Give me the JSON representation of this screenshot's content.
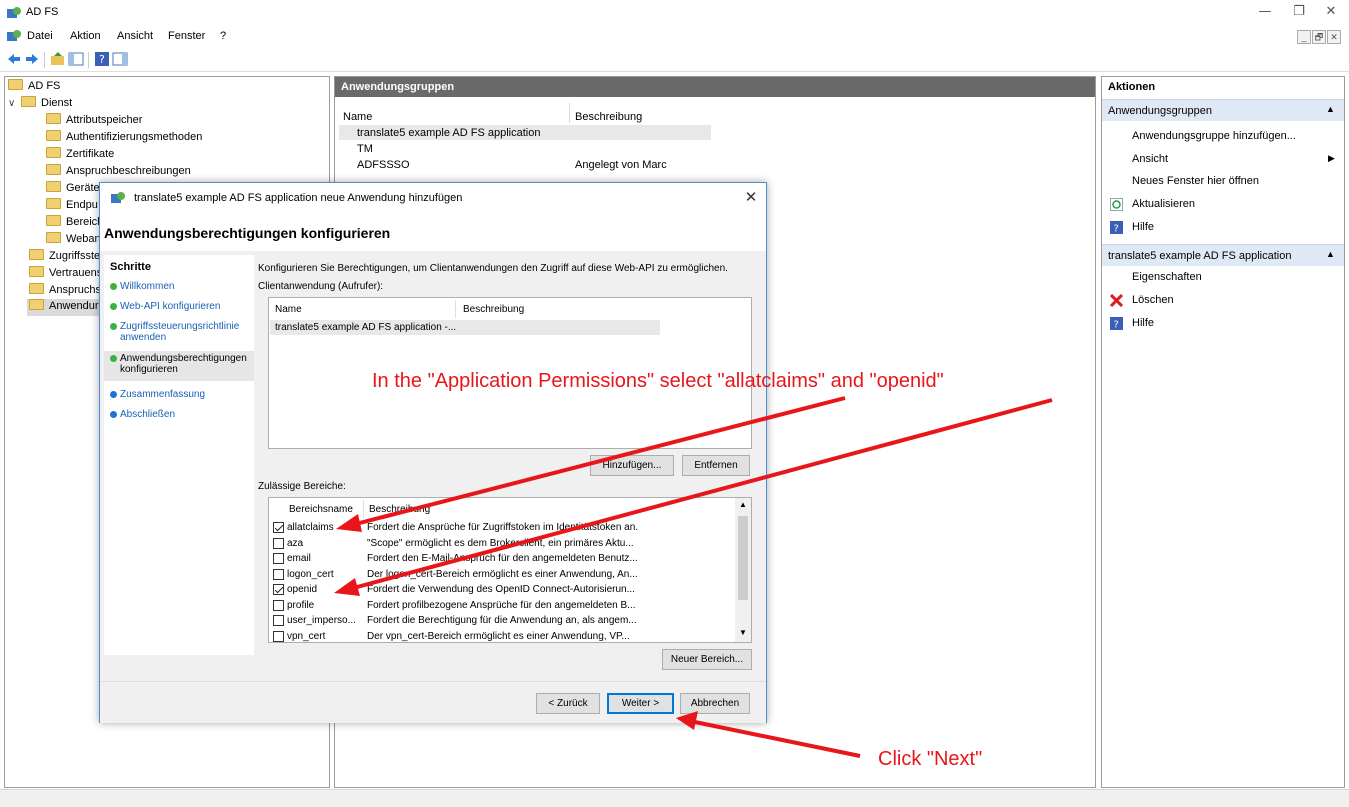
{
  "app": {
    "title": "AD FS",
    "menu": [
      "Datei",
      "Aktion",
      "Ansicht",
      "Fenster",
      "?"
    ],
    "window_controls": {
      "minimize": "—",
      "maximize": "❐",
      "close": "✕"
    },
    "mdi_controls": {
      "minimize": "_",
      "restore": "🗗",
      "close": "✕"
    }
  },
  "tree": {
    "root": "AD FS",
    "dienst": "Dienst",
    "dienst_children": [
      "Attributspeicher",
      "Authentifizierungsmethoden",
      "Zertifikate",
      "Anspruchbeschreibungen",
      "Geräter",
      "Endpu",
      "Bereich",
      "Weban"
    ],
    "others": [
      "Zugriffsste",
      "Vertrauens",
      "Anspruchs",
      "Anwendur"
    ]
  },
  "center": {
    "header": "Anwendungsgruppen",
    "columns": [
      "Name",
      "Beschreibung"
    ],
    "rows": [
      {
        "name": "translate5 example AD FS application",
        "desc": ""
      },
      {
        "name": "TM",
        "desc": ""
      },
      {
        "name": "ADFSSSO",
        "desc": "Angelegt von Marc"
      }
    ]
  },
  "actions": {
    "header": "Aktionen",
    "section1": {
      "title": "Anwendungsgruppen",
      "items": [
        "Anwendungsgruppe hinzufügen...",
        "Ansicht",
        "Neues Fenster hier öffnen",
        "Aktualisieren",
        "Hilfe"
      ]
    },
    "section2": {
      "title": "translate5 example AD FS application",
      "items": [
        "Eigenschaften",
        "Löschen",
        "Hilfe"
      ]
    }
  },
  "dialog": {
    "title": "translate5 example AD FS application neue Anwendung hinzufügen",
    "heading": "Anwendungsberechtigungen konfigurieren",
    "steps_header": "Schritte",
    "steps": [
      {
        "label": "Willkommen",
        "color": "#3cb043"
      },
      {
        "label": "Web-API konfigurieren",
        "color": "#3cb043"
      },
      {
        "label": "Zugriffssteuerungsrichtlinie anwenden",
        "color": "#3cb043"
      },
      {
        "label": "Anwendungsberechtigungen konfigurieren",
        "color": "#3cb043"
      },
      {
        "label": "Zusammenfassung",
        "color": "#1e73d2"
      },
      {
        "label": "Abschließen",
        "color": "#1e73d2"
      }
    ],
    "intro": "Konfigurieren Sie Berechtigungen, um Clientanwendungen den Zugriff auf diese Web-API zu ermöglichen.",
    "client_label": "Clientanwendung (Aufrufer):",
    "client_columns": [
      "Name",
      "Beschreibung"
    ],
    "client_rows": [
      "translate5 example AD FS application -..."
    ],
    "add_button": "Hinzufügen...",
    "remove_button": "Entfernen",
    "scopes_label": "Zulässige Bereiche:",
    "scope_columns": [
      "Bereichsname",
      "Beschreibung"
    ],
    "scopes": [
      {
        "name": "allatclaims",
        "desc": "Fordert die Ansprüche für Zugriffstoken im Identitätstoken an.",
        "checked": true
      },
      {
        "name": "aza",
        "desc": "\"Scope\" ermöglicht es dem Brokerclient, ein primäres Aktu...",
        "checked": false
      },
      {
        "name": "email",
        "desc": "Fordert den E-Mail-Anspruch für den angemeldeten Benutz...",
        "checked": false
      },
      {
        "name": "logon_cert",
        "desc": "Der logon_cert-Bereich ermöglicht es einer Anwendung, An...",
        "checked": false
      },
      {
        "name": "openid",
        "desc": "Fordert die Verwendung des OpenID Connect-Autorisierun...",
        "checked": true
      },
      {
        "name": "profile",
        "desc": "Fordert profilbezogene Ansprüche für den angemeldeten B...",
        "checked": false
      },
      {
        "name": "user_imperso...",
        "desc": "Fordert die Berechtigung für die Anwendung an, als angem...",
        "checked": false
      },
      {
        "name": "vpn_cert",
        "desc": "Der vpn_cert-Bereich ermöglicht es einer Anwendung, VP...",
        "checked": false
      }
    ],
    "new_scope_button": "Neuer Bereich...",
    "back_button": "< Zurück",
    "next_button": "Weiter >",
    "cancel_button": "Abbrechen",
    "close": "✕"
  },
  "annotations": {
    "select_note": "In the \"Application Permissions\" select \"allatclaims\" and \"openid\"",
    "next_note": "Click \"Next\"",
    "color": "#e8161b"
  }
}
